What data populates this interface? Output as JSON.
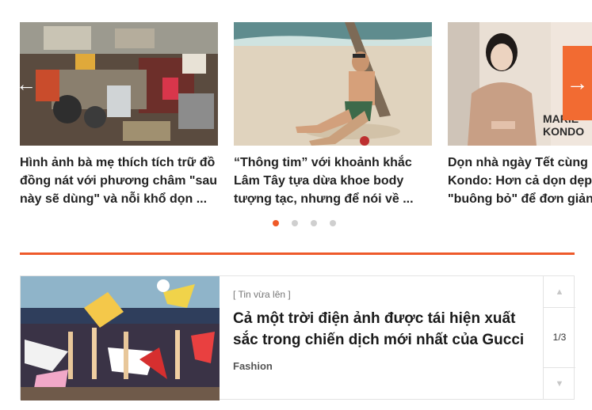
{
  "carousel": {
    "cards": [
      {
        "title": "Hình ảnh bà mẹ thích tích trữ đồ đồng nát với phương châm \"sau này sẽ dùng\" và nỗi khổ dọn ..."
      },
      {
        "title": "“Thông tim” với khoảnh khắc Lâm Tây tựa dừa khoe body tượng tạc, nhưng để nói về ..."
      },
      {
        "title": "Dọn nhà ngày Tết cùng Marie Kondo: Hơn cả dọn dẹp, là \"buông bỏ\" để đơn giản ...",
        "logo_text_1": "MARIE",
        "logo_text_2": "KONDO"
      }
    ],
    "prev_icon": "arrow-left-icon",
    "next_icon": "arrow-right-icon",
    "prev_glyph": "←",
    "next_glyph": "→",
    "dots": 4,
    "active_dot": 1
  },
  "accent_color": "#ef5a28",
  "feature": {
    "tag": "[ Tin vừa lên ]",
    "title": "Cả một trời điện ảnh được tái hiện xuất sắc trong chiến dịch mới nhất của Gucci",
    "category": "Fashion",
    "pager": {
      "position": "1/3",
      "up_glyph": "▲",
      "down_glyph": "▼"
    }
  }
}
